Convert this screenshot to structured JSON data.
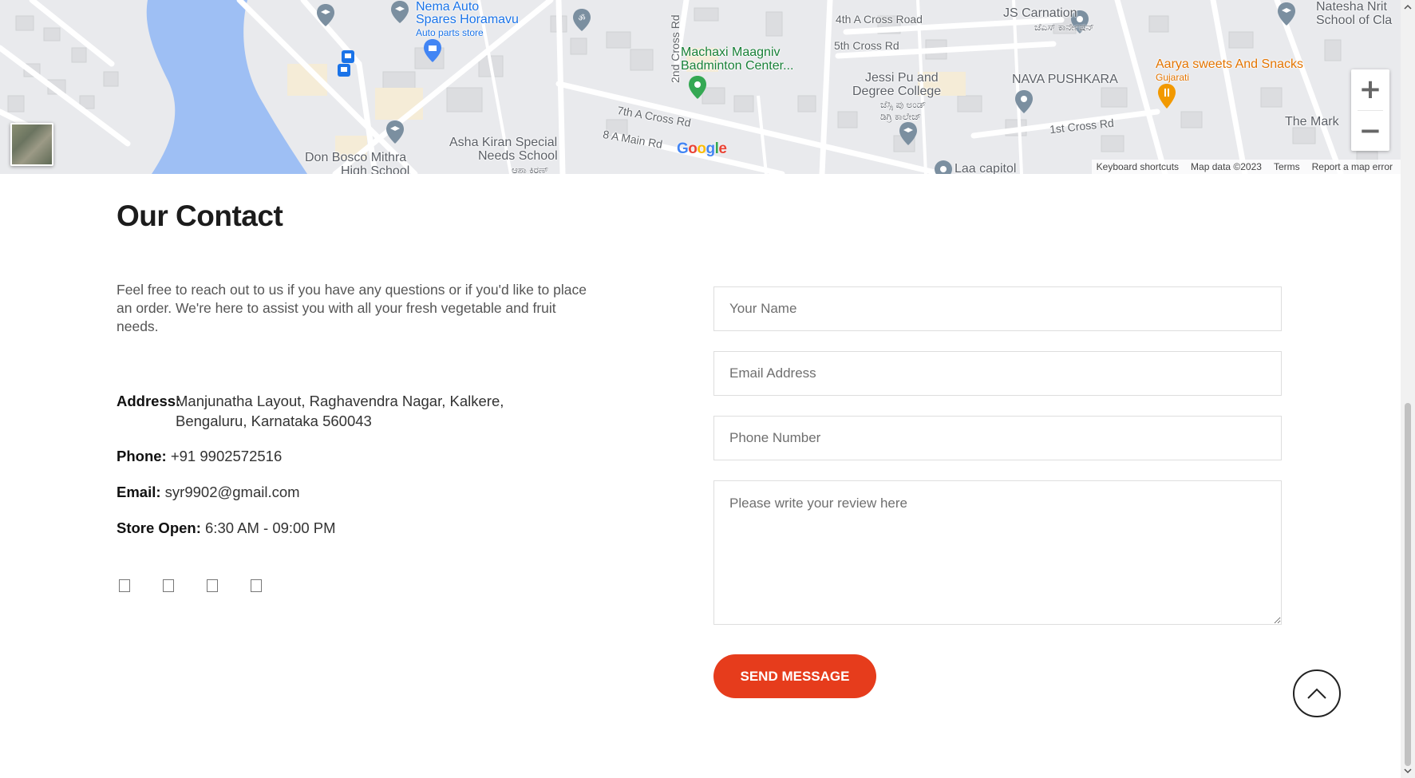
{
  "map": {
    "labels": {
      "nema_auto": "Nema Auto",
      "spares_horamavu": "Spares Horamavu",
      "auto_parts_store": "Auto parts store",
      "machaxi_1": "Machaxi Maagniv",
      "machaxi_2": "Badminton Center...",
      "fourth_a_cross": "4th A Cross Road",
      "fifth_cross": "5th Cross Rd",
      "js_carnation": "JS Carnation",
      "js_carnation_kn": "ಜೆಎಸ್ ಕಾರ್ನೇಷನ್",
      "natesha": "Natesha Nrit",
      "school_of": "School of Cla",
      "aarya": "Aarya sweets And Snacks",
      "gujarati": "Gujarati",
      "jessi_1": "Jessi Pu and",
      "jessi_2": "Degree College",
      "jessi_kn1": "ಜೆಸ್ಸಿ ಪು ಅಂಡ್",
      "jessi_kn2": "ಡಿಗ್ರಿ ಕಾಲೇಜ್",
      "nava_pushkara": "NAVA PUSHKARA",
      "first_cross": "1st Cross Rd",
      "the_mark": "The Mark",
      "seventh_a_cross": "7th A Cross Rd",
      "eight_a_main": "8 A Main Rd",
      "second_cross": "2nd Cross Rd",
      "asha_1": "Asha Kiran Special",
      "asha_2": "Needs School",
      "asha_kn": "ಆಶಾ ಕಿರಣ್",
      "don_bosco_1": "Don Bosco Mithra",
      "don_bosco_2": "High School",
      "laa_capitol": "Laa capitol"
    },
    "google": [
      "G",
      "o",
      "o",
      "g",
      "l",
      "e"
    ],
    "footer": {
      "shortcuts": "Keyboard shortcuts",
      "map_data": "Map data ©2023",
      "terms": "Terms",
      "report": "Report a map error"
    },
    "zoom_in": "+",
    "zoom_out": "−",
    "colors": {
      "water": "#9ebff4",
      "road": "#ffffff",
      "land": "#e9eaed",
      "building": "#dcdde0"
    }
  },
  "contact": {
    "title": "Our Contact",
    "intro": "Feel free to reach out to us if you have any questions or if you'd like to place an order. We're here to assist you with all your fresh vegetable and fruit needs.",
    "address_label": "Address:",
    "address_line1": "Manjunatha Layout, Raghavendra Nagar, Kalkere,",
    "address_line2": "Bengaluru, Karnataka 560043",
    "phone_label": "Phone:",
    "phone_value": "+91 9902572516",
    "email_label": "Email:",
    "email_value": "syr9902@gmail.com",
    "hours_label": "Store Open:",
    "hours_value": "6:30 AM - 09:00 PM",
    "social_icons": [
      "facebook-icon",
      "twitter-icon",
      "instagram-icon",
      "youtube-icon"
    ]
  },
  "form": {
    "name_placeholder": "Your Name",
    "email_placeholder": "Email Address",
    "phone_placeholder": "Phone Number",
    "review_placeholder": "Please write your review here",
    "submit_label": "SEND MESSAGE",
    "accent_color": "#e63c1c"
  }
}
